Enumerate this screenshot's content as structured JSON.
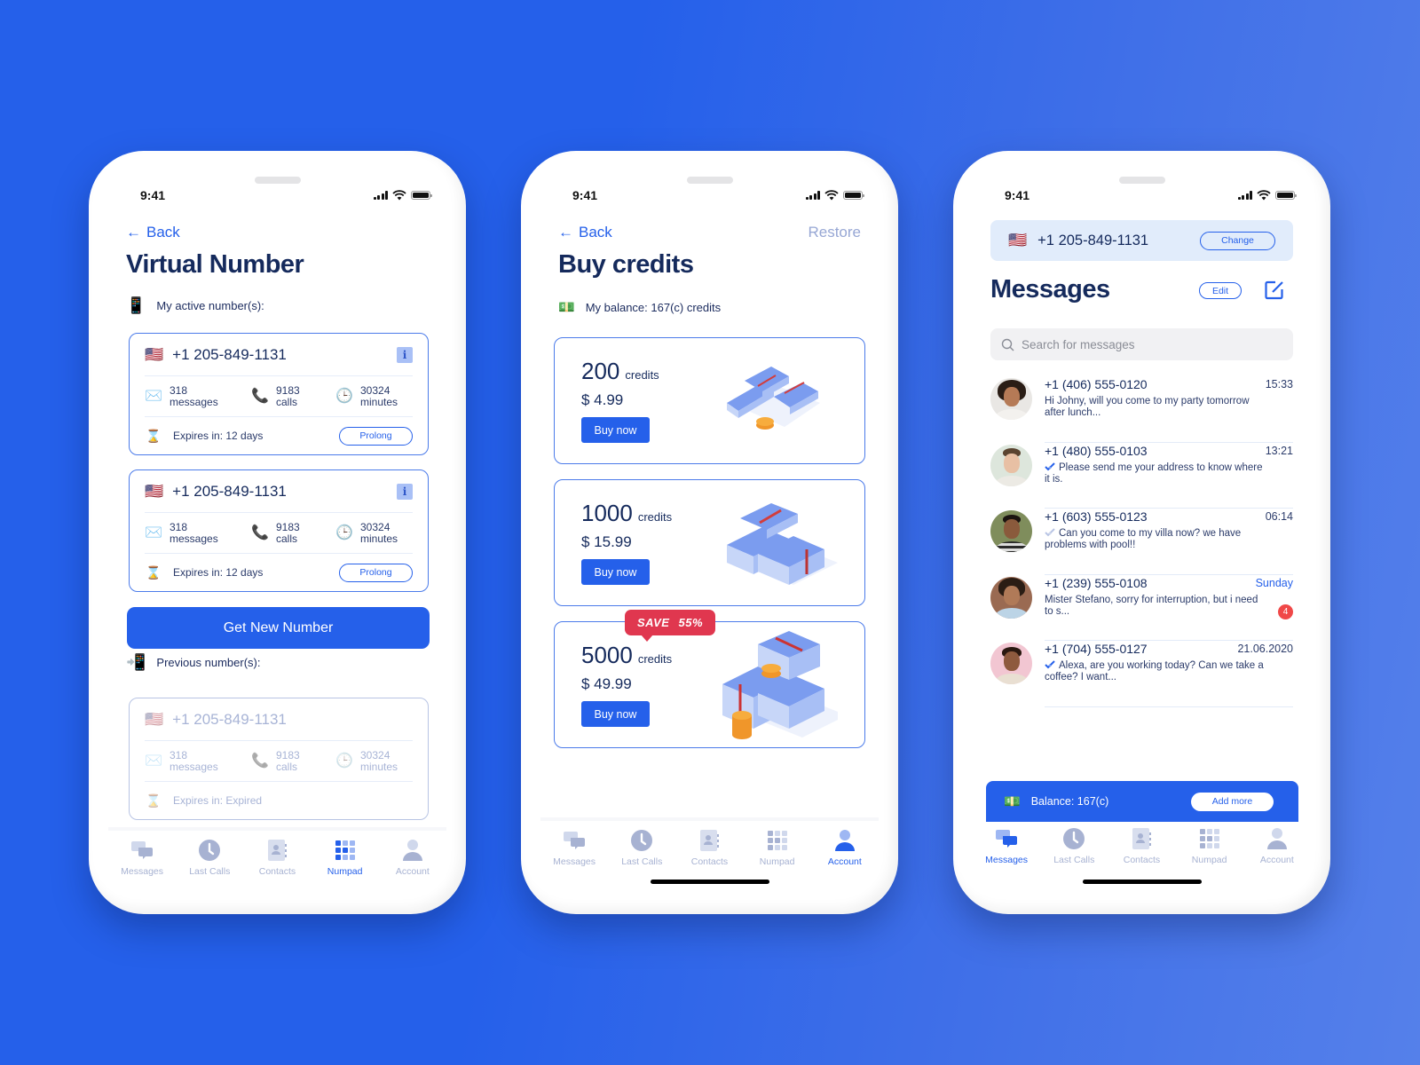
{
  "colors": {
    "accent": "#2560ea",
    "title": "#152a5c",
    "muted": "#a7b2d2",
    "save": "#e0374f",
    "badge": "#f04848"
  },
  "status_bar": {
    "time": "9:41"
  },
  "tabs": [
    "Messages",
    "Last Calls",
    "Contacts",
    "Numpad",
    "Account"
  ],
  "screen1": {
    "back": "Back",
    "title": "Virtual Number",
    "active_label": "My active number(s):",
    "active_icon": "mobile-phone-icon",
    "active_numbers": [
      {
        "flag": "🇺🇸",
        "number": "+1 205-849-1131",
        "messages": "318",
        "messages_label": "messages",
        "calls": "9183",
        "calls_label": "calls",
        "minutes": "30324",
        "minutes_label": "minutes",
        "expires": "Expires in: 12 days",
        "action": "Prolong"
      },
      {
        "flag": "🇺🇸",
        "number": "+1 205-849-1131",
        "messages": "318",
        "messages_label": "messages",
        "calls": "9183",
        "calls_label": "calls",
        "minutes": "30324",
        "minutes_label": "minutes",
        "expires": "Expires in: 12 days",
        "action": "Prolong"
      }
    ],
    "get_new_number": "Get New Number",
    "previous_label": "Previous number(s):",
    "previous_numbers": [
      {
        "flag": "🇺🇸",
        "number": "+1 205-849-1131",
        "messages": "318",
        "messages_label": "messages",
        "calls": "9183",
        "calls_label": "calls",
        "minutes": "30324",
        "minutes_label": "minutes",
        "expires": "Expires in: Expired"
      }
    ],
    "active_tab": "Numpad"
  },
  "screen2": {
    "back": "Back",
    "restore": "Restore",
    "title": "Buy credits",
    "balance": "My balance: 167(c) credits",
    "packages": [
      {
        "amount": "200",
        "unit": "credits",
        "price": "$ 4.99",
        "button": "Buy now"
      },
      {
        "amount": "1000",
        "unit": "credits",
        "price": "$ 15.99",
        "button": "Buy now"
      },
      {
        "amount": "5000",
        "unit": "credits",
        "price": "$ 49.99",
        "button": "Buy now",
        "badge": "SAVE 55%"
      }
    ],
    "active_tab": "Account"
  },
  "screen3": {
    "active_number": {
      "flag": "🇺🇸",
      "number": "+1 205-849-1131",
      "change": "Change"
    },
    "title": "Messages",
    "edit": "Edit",
    "search_placeholder": "Search for messages",
    "messages": [
      {
        "phone": "+1 (406) 555-0120",
        "time": "15:33",
        "preview": "Hi Johny, will you come to my party tomorrow after lunch...",
        "check": "none"
      },
      {
        "phone": "+1 (480) 555-0103",
        "time": "13:21",
        "preview": "Please send me your address to know where it is.",
        "check": "read"
      },
      {
        "phone": "+1 (603) 555-0123",
        "time": "06:14",
        "preview": "Can you come to my villa now? we have problems with pool!!",
        "check": "sent"
      },
      {
        "phone": "+1 (239) 555-0108",
        "time": "Sunday",
        "preview": "Mister Stefano, sorry for interruption, but i need to s...",
        "check": "none",
        "unread": "4"
      },
      {
        "phone": "+1 (704) 555-0127",
        "time": "21.06.2020",
        "preview": "Alexa, are you working today? Can we take a coffee? I want...",
        "check": "read"
      }
    ],
    "balance": "Balance: 167(c)",
    "add_more": "Add more",
    "active_tab": "Messages"
  }
}
